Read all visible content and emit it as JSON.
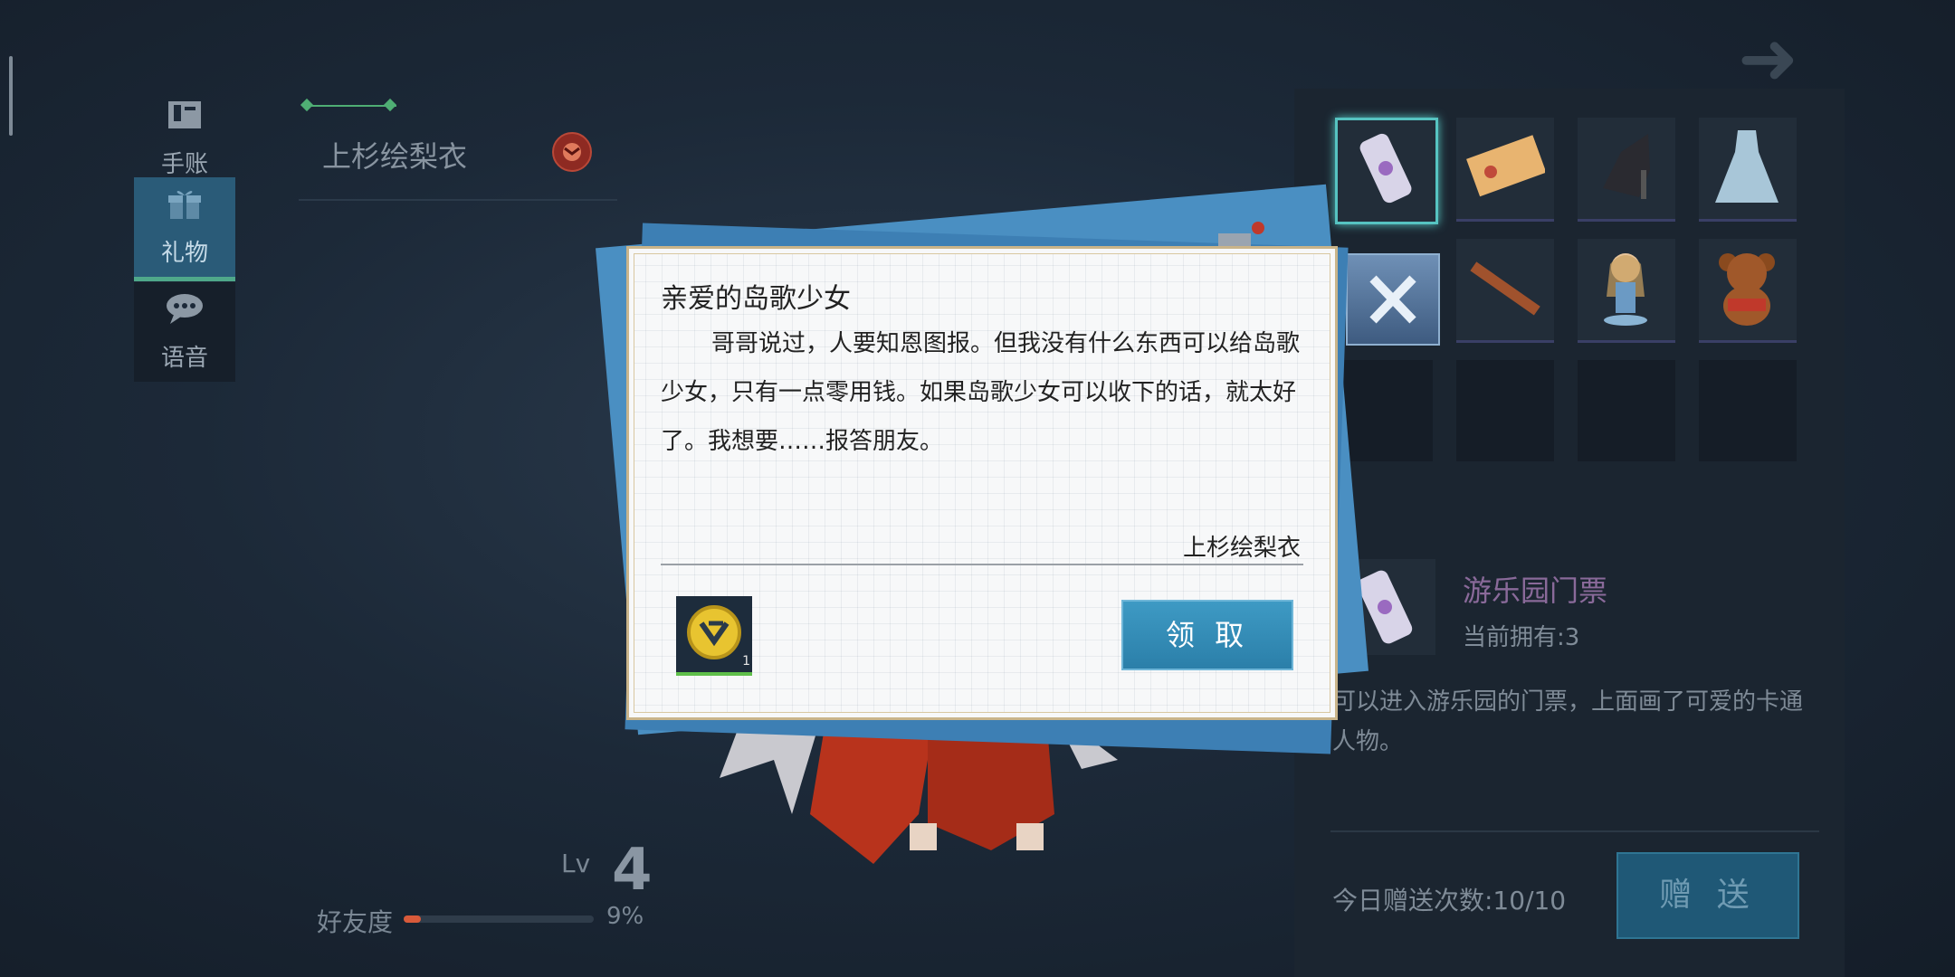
{
  "nav": {
    "items": [
      {
        "label": "手账",
        "icon": "journal-icon"
      },
      {
        "label": "礼物",
        "icon": "gift-icon",
        "active": true
      },
      {
        "label": "语音",
        "icon": "voice-chat-icon"
      }
    ]
  },
  "character": {
    "name": "上杉绘梨衣",
    "level_label": "Lv",
    "level": "4",
    "affinity_label": "好友度",
    "affinity_pct": "9%",
    "affinity_value": 0.09
  },
  "dialog": {
    "title": "亲爱的岛歌少女",
    "body": "哥哥说过，人要知恩图报。但我没有什么东西可以给岛歌少女，只有一点零用钱。如果岛歌少女可以收下的话，就太好了。我想要……报答朋友。",
    "signature": "上杉绘梨衣",
    "reward_count": "1",
    "claim_label": "领 取"
  },
  "gift_panel": {
    "items": [
      {
        "icon": "amusement-park-ticket-icon",
        "selected": true
      },
      {
        "icon": "coupon-ticket-icon"
      },
      {
        "icon": "high-heel-shoe-icon"
      },
      {
        "icon": "blue-dress-icon"
      },
      {
        "icon": "close-icon"
      },
      {
        "icon": "wooden-stick-icon"
      },
      {
        "icon": "figurine-doll-icon"
      },
      {
        "icon": "teddy-bear-icon"
      }
    ],
    "selected_name": "游乐园门票",
    "selected_owned": "当前拥有:3",
    "selected_desc": "可以进入游乐园的门票，上面画了可爱的卡通人物。",
    "daily_count": "今日赠送次数:10/10",
    "send_label": "赠 送"
  },
  "colors": {
    "accent_green": "#4fae74",
    "button_blue": "#2b7fa9",
    "dialog_gold": "#c9b48a"
  }
}
